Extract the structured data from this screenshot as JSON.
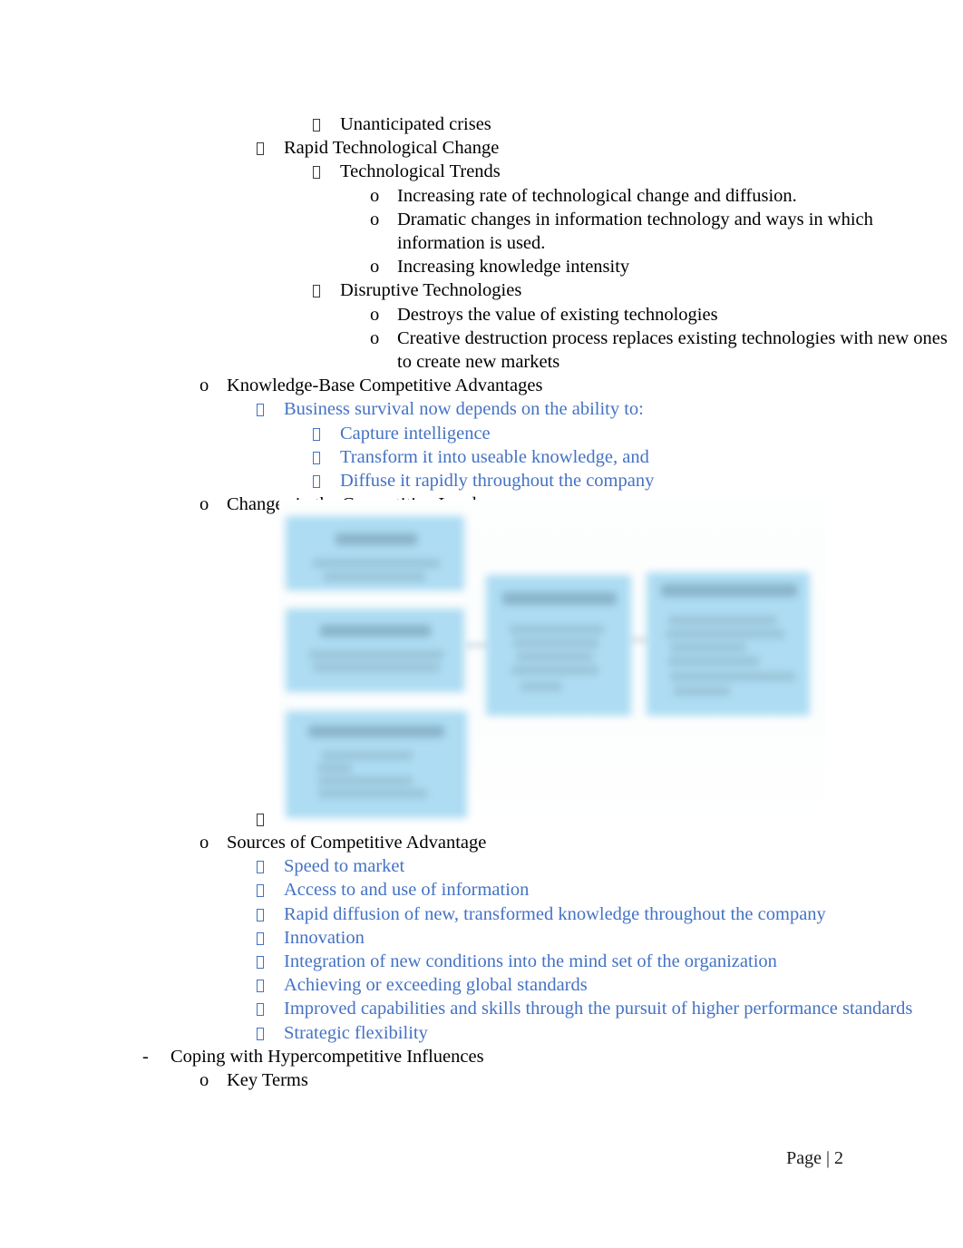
{
  "document": {
    "page_background": "#ffffff",
    "body_text_color": "#000000",
    "accent_blue": "#4472C4",
    "diagram_box_fill": "#addcf3"
  },
  "outline": [
    {
      "id": "unanticipated-crises",
      "marker": "tofu",
      "level": "b2",
      "color": "black",
      "text": "Unanticipated crises"
    },
    {
      "id": "rapid-technological-change",
      "marker": "tofu",
      "level": "b1",
      "color": "black",
      "text": "Rapid Technological Change"
    },
    {
      "id": "technological-trends",
      "marker": "tofu",
      "level": "b2",
      "color": "black",
      "text": "Technological Trends"
    },
    {
      "id": "increasing-rate",
      "marker": "o",
      "level": "o2",
      "color": "black",
      "text": "Increasing rate of technological change and diffusion."
    },
    {
      "id": "dramatic-changes-it",
      "marker": "o",
      "level": "o2",
      "color": "black",
      "text": "Dramatic changes in information technology and ways in which information is used."
    },
    {
      "id": "increasing-knowledge-intensity",
      "marker": "o",
      "level": "o2",
      "color": "black",
      "text": "Increasing knowledge intensity"
    },
    {
      "id": "disruptive-technologies",
      "marker": "tofu",
      "level": "b2",
      "color": "black",
      "text": "Disruptive Technologies"
    },
    {
      "id": "destroys-value",
      "marker": "o",
      "level": "o2",
      "color": "black",
      "text": "Destroys the value of existing technologies"
    },
    {
      "id": "creative-destruction",
      "marker": "o",
      "level": "o2",
      "color": "black",
      "text": "Creative destruction process replaces existing technologies with new ones to create new markets"
    },
    {
      "id": "knowledge-base-competitive-advantages",
      "marker": "o",
      "level": "o1",
      "color": "black",
      "text": "Knowledge-Base Competitive Advantages"
    },
    {
      "id": "business-survival",
      "marker": "tofu",
      "level": "b1",
      "color": "blue",
      "text": "Business survival now depends on the ability to:"
    },
    {
      "id": "capture-intelligence",
      "marker": "tofu",
      "level": "b2",
      "color": "blue",
      "text": "Capture intelligence"
    },
    {
      "id": "transform-useable-knowledge",
      "marker": "tofu",
      "level": "b2",
      "color": "blue",
      "text": "Transform it into useable knowledge, and"
    },
    {
      "id": "diffuse-rapidly",
      "marker": "tofu",
      "level": "b2",
      "color": "blue",
      "text": "Diffuse it rapidly throughout the company"
    },
    {
      "id": "changes-competitive-landscape",
      "marker": "o",
      "level": "o1",
      "color": "black",
      "text": "Changes in the Competitive Landscape"
    }
  ],
  "diagram": {
    "name": "changes-in-the-competitive-landscape-diagram",
    "description": "Blurred SmartArt-style diagram: three stacked light-blue boxes on the left connected to two larger light-blue boxes on the right; all box text is blurred and unreadable.",
    "boxes": [
      {
        "id": "left-top"
      },
      {
        "id": "left-middle"
      },
      {
        "id": "left-bottom"
      },
      {
        "id": "center"
      },
      {
        "id": "right"
      }
    ],
    "anchor_bullet": {
      "marker": "tofu",
      "level": "b1",
      "text": ""
    }
  },
  "outline_after": [
    {
      "id": "sources-of-competitive-advantage",
      "marker": "o",
      "level": "o1",
      "color": "black",
      "text": "Sources of Competitive Advantage"
    },
    {
      "id": "speed-to-market",
      "marker": "tofu",
      "level": "b1",
      "color": "blue",
      "text": "Speed to market"
    },
    {
      "id": "access-use-information",
      "marker": "tofu",
      "level": "b1",
      "color": "blue",
      "text": "Access to and use of information"
    },
    {
      "id": "rapid-diffusion-knowledge",
      "marker": "tofu",
      "level": "b1",
      "color": "blue",
      "text": "Rapid diffusion of new, transformed knowledge throughout the company"
    },
    {
      "id": "innovation",
      "marker": "tofu",
      "level": "b1",
      "color": "blue",
      "text": "Innovation"
    },
    {
      "id": "integration-new-conditions",
      "marker": "tofu",
      "level": "b1",
      "color": "blue",
      "text": "Integration of new conditions into the mind set of the organization"
    },
    {
      "id": "achieving-global-standards",
      "marker": "tofu",
      "level": "b1",
      "color": "blue",
      "text": "Achieving or exceeding global standards"
    },
    {
      "id": "improved-capabilities",
      "marker": "tofu",
      "level": "b1",
      "color": "blue",
      "text": "Improved capabilities and skills through the pursuit of higher performance standards"
    },
    {
      "id": "strategic-flexibility",
      "marker": "tofu",
      "level": "b1",
      "color": "blue",
      "text": "Strategic flexibility"
    },
    {
      "id": "coping-hypercompetitive",
      "marker": "dash",
      "level": "dash",
      "color": "black",
      "text": "Coping with Hypercompetitive Influences"
    },
    {
      "id": "key-terms",
      "marker": "o",
      "level": "o1",
      "color": "black",
      "text": "Key Terms"
    }
  ],
  "footer": {
    "text": "Page | 2"
  }
}
